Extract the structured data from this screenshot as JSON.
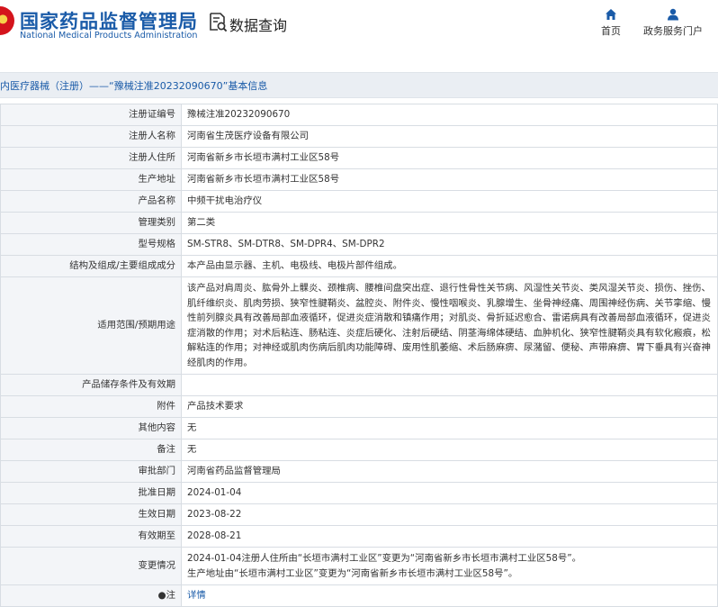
{
  "header": {
    "site_name_cn": "国家药品监督管理局",
    "site_name_en": "National Medical Products Administration",
    "search_label": "数据查询",
    "nav": [
      {
        "label": "首页",
        "icon": "home-icon"
      },
      {
        "label": "政务服务门户",
        "icon": "user-icon"
      }
    ]
  },
  "titlebar": {
    "text": "内医疗器械（注册）——“豫械注准20232090670”基本信息"
  },
  "rows": [
    {
      "label": "注册证编号",
      "value": "豫械注准20232090670"
    },
    {
      "label": "注册人名称",
      "value": "河南省生茂医疗设备有限公司"
    },
    {
      "label": "注册人住所",
      "value": "河南省新乡市长垣市满村工业区58号"
    },
    {
      "label": "生产地址",
      "value": "河南省新乡市长垣市满村工业区58号"
    },
    {
      "label": "产品名称",
      "value": "中频干扰电治疗仪"
    },
    {
      "label": "管理类别",
      "value": "第二类"
    },
    {
      "label": "型号规格",
      "value": "SM-STR8、SM-DTR8、SM-DPR4、SM-DPR2"
    },
    {
      "label": "结构及组成/主要组成成分",
      "value": "本产品由显示器、主机、电极线、电极片部件组成。"
    },
    {
      "label": "适用范围/预期用途",
      "value": "该产品对肩周炎、肱骨外上髁炎、颈椎病、腰椎间盘突出症、退行性骨性关节病、风湿性关节炎、类风湿关节炎、损伤、挫伤、肌纤维织炎、肌肉劳损、狭窄性腱鞘炎、盆腔炎、附件炎、慢性咽喉炎、乳腺增生、坐骨神经痛、周围神经伤病、关节挛缩、慢性前列腺炎具有改善局部血液循环，促进炎症消散和镇痛作用；对肌炎、骨折延迟愈合、雷诺病具有改善局部血液循环，促进炎症消散的作用；对术后粘连、肠粘连、炎症后硬化、注射后硬结、阴茎海绵体硬结、血肿机化、狭窄性腱鞘炎具有软化瘢痕，松解粘连的作用；对神经或肌肉伤病后肌肉功能障碍、废用性肌萎缩、术后肠麻痹、尿潴留、便秘、声带麻痹、胃下垂具有兴奋神经肌肉的作用。"
    },
    {
      "label": "产品储存条件及有效期",
      "value": ""
    },
    {
      "label": "附件",
      "value": "产品技术要求"
    },
    {
      "label": "其他内容",
      "value": "无"
    },
    {
      "label": "备注",
      "value": "无"
    },
    {
      "label": "审批部门",
      "value": "河南省药品监督管理局"
    },
    {
      "label": "批准日期",
      "value": "2024-01-04"
    },
    {
      "label": "生效日期",
      "value": "2023-08-22"
    },
    {
      "label": "有效期至",
      "value": "2028-08-21"
    },
    {
      "label": "变更情况",
      "value_lines": [
        "2024-01-04注册人住所由“长垣市满村工业区”变更为“河南省新乡市长垣市满村工业区58号”。",
        "生产地址由“长垣市满村工业区”变更为“河南省新乡市长垣市满村工业区58号”。"
      ]
    },
    {
      "label": "●注",
      "value": "详情",
      "icon": "pin-icon"
    }
  ],
  "colors": {
    "brand_blue": "#1a5ba8",
    "label_bg": "#f3f5f8",
    "titlebar_bg": "#eaeef3"
  }
}
